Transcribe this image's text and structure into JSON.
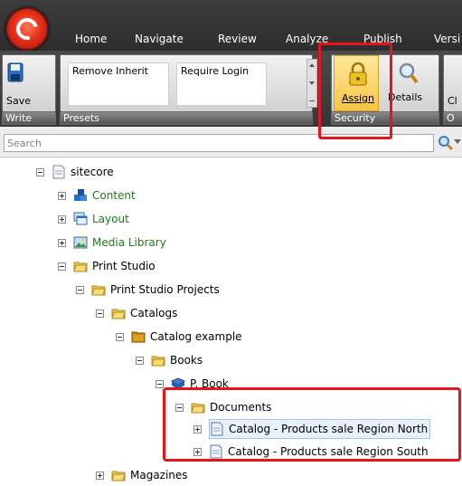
{
  "ribbon": {
    "tabs": [
      {
        "label": "Home"
      },
      {
        "label": "Navigate"
      },
      {
        "label": "Review"
      },
      {
        "label": "Analyze"
      },
      {
        "label": "Publish"
      },
      {
        "label": "Versi"
      }
    ],
    "write": {
      "save_label": "Save",
      "group_label": "Write"
    },
    "presets": {
      "remove_inherit": "Remove Inherit",
      "require_login": "Require Login",
      "group_label": "Presets"
    },
    "security": {
      "assign_label": "Assign",
      "details_label": "Details",
      "group_label": "Security"
    },
    "next_group": {
      "button_label": "Cl",
      "group_label": "O"
    }
  },
  "search": {
    "placeholder": "Search"
  },
  "tree": {
    "sitecore": "sitecore",
    "content": "Content",
    "layout": "Layout",
    "media_library": "Media Library",
    "print_studio": "Print Studio",
    "print_studio_projects": "Print Studio Projects",
    "catalogs": "Catalogs",
    "catalog_example": "Catalog example",
    "books": "Books",
    "p_book": "P. Book",
    "documents": "Documents",
    "catalog_north": "Catalog - Products sale Region North",
    "catalog_south": "Catalog - Products sale Region South",
    "magazines": "Magazines"
  },
  "colors": {
    "highlight": "#e8141c",
    "green_label": "#1c7a1c",
    "ribbon_dark": "#3a3a3a"
  }
}
